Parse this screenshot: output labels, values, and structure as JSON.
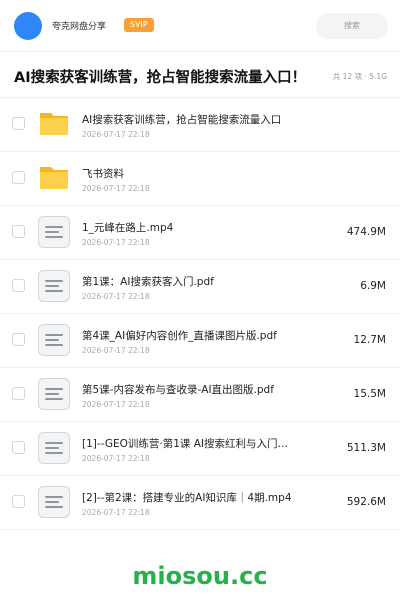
{
  "header": {
    "user_name": "夸克网盘分享",
    "badge": "SVIP",
    "search_placeholder": "搜索"
  },
  "folder": {
    "title": "AI搜索获客训练营，抢占智能搜索流量入口！",
    "meta": "共 12 项 · 5.1G"
  },
  "files": [
    {
      "name": "AI搜索获客训练营，抢占智能搜索流量入口",
      "date": "2026-07-17 22:18",
      "size": "",
      "type": "folder"
    },
    {
      "name": "飞书资料",
      "date": "2026-07-17 22:18",
      "size": "",
      "type": "folder"
    },
    {
      "name": "1_元峰在路上.mp4",
      "date": "2026-07-17 22:18",
      "size": "474.9M",
      "type": "file"
    },
    {
      "name": "第1课：AI搜索获客入门.pdf",
      "date": "2026-07-17 22:18",
      "size": "6.9M",
      "type": "file"
    },
    {
      "name": "第4课_AI偏好内容创作_直播课图片版.pdf",
      "date": "2026-07-17 22:18",
      "size": "12.7M",
      "type": "file"
    },
    {
      "name": "第5课-内容发布与查收录-AI直出图版.pdf",
      "date": "2026-07-17 22:18",
      "size": "15.5M",
      "type": "file"
    },
    {
      "name": "[1]--GEO训练营·第1课 AI搜索红利与入门…",
      "date": "2026-07-17 22:18",
      "size": "511.3M",
      "type": "file"
    },
    {
      "name": "[2]--第2课：搭建专业的AI知识库｜4期.mp4",
      "date": "2026-07-17 22:18",
      "size": "592.6M",
      "type": "file"
    }
  ],
  "watermark": "miosou.cc",
  "colors": {
    "avatar": "#2f86f6",
    "badge": "#f7a134",
    "folder": "#fbc531",
    "watermark": "#28b04c"
  },
  "icons": {
    "folder": "folder-icon",
    "file": "document-icon"
  }
}
